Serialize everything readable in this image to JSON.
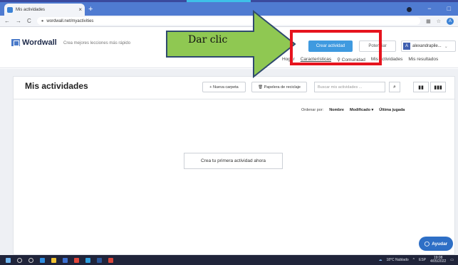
{
  "browser": {
    "tab_title": "Mis actividades",
    "tab_close": "×",
    "new_tab": "+",
    "url": "wordwall.net/myactivities",
    "lock": "🔒",
    "back": "←",
    "forward": "→",
    "reload": "C",
    "profile_initial": "A",
    "minimize": "−",
    "maximize": "□"
  },
  "site": {
    "logo": "Wordwall",
    "tagline": "Crea mejores lecciones más rápido",
    "crear_actividad": "Crear actividad",
    "potenciar": "Potenciar",
    "user_initial": "A",
    "user_name": "alexandrapile...",
    "user_caret": "⌄",
    "nav": [
      "Hogar",
      "Características",
      "Comunidad",
      "Mis actividades",
      "Mis resultados"
    ]
  },
  "annotation": {
    "label": "Dar clic",
    "arrow_color": "#8fc852",
    "box_color": "#e6141e"
  },
  "main": {
    "title": "Mis actividades",
    "new_folder": "+ Nueva carpeta",
    "recycle_bin": "🗑 Papelera de reciclaje",
    "search_placeholder": "Buscar mis actividades ...",
    "search_icon": "🔍",
    "sort_label": "Ordenar por:",
    "sort_name": "Nombre",
    "sort_modified": "Modificado ▾",
    "sort_last_played": "Última jugada",
    "empty_cta": "Crea tu primera actividad ahora",
    "help": "Ayudar"
  },
  "taskbar": {
    "weather": "18°C Nublado",
    "lang": "ESP",
    "time": "19:08",
    "date": "4/05/2022"
  },
  "colors": {
    "accent": "#3f9ae0",
    "help": "#2e6fc6",
    "taskbar": "#20243a"
  }
}
